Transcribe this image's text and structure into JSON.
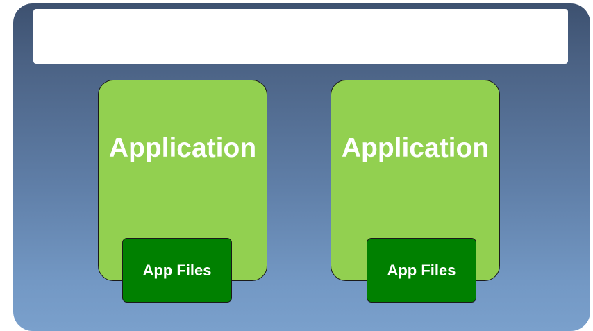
{
  "diagram": {
    "header": {
      "text": ""
    },
    "applications": [
      {
        "label": "Application",
        "files_label": "App Files"
      },
      {
        "label": "Application",
        "files_label": "App Files"
      }
    ],
    "colors": {
      "panel_top": "#3d5170",
      "panel_bottom": "#7aa0cc",
      "application_fill": "#92d050",
      "files_fill": "#008000",
      "text": "#ffffff"
    }
  }
}
